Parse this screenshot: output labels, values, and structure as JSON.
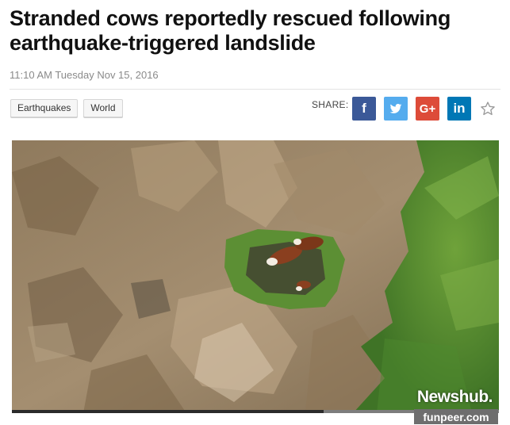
{
  "article": {
    "headline": "Stranded cows reportedly rescued following earthquake-triggered landslide",
    "dateline": "11:10 AM Tuesday Nov 15, 2016"
  },
  "tags": [
    "Earthquakes",
    "World"
  ],
  "share": {
    "label": "SHARE:",
    "buttons": [
      {
        "name": "facebook",
        "glyph": "f",
        "icon": "facebook-icon",
        "color": "#3b5998"
      },
      {
        "name": "twitter",
        "glyph": "",
        "icon": "twitter-icon",
        "color": "#55acee"
      },
      {
        "name": "google-plus",
        "glyph": "G+",
        "icon": "google-plus-icon",
        "color": "#dd4b39"
      },
      {
        "name": "linkedin",
        "glyph": "in",
        "icon": "linkedin-icon",
        "color": "#0077b5"
      }
    ],
    "favorite_icon": "star-icon"
  },
  "photo": {
    "watermark": "Newshub.",
    "video_progress": 0.64
  },
  "source_watermark": "funpeer.com"
}
